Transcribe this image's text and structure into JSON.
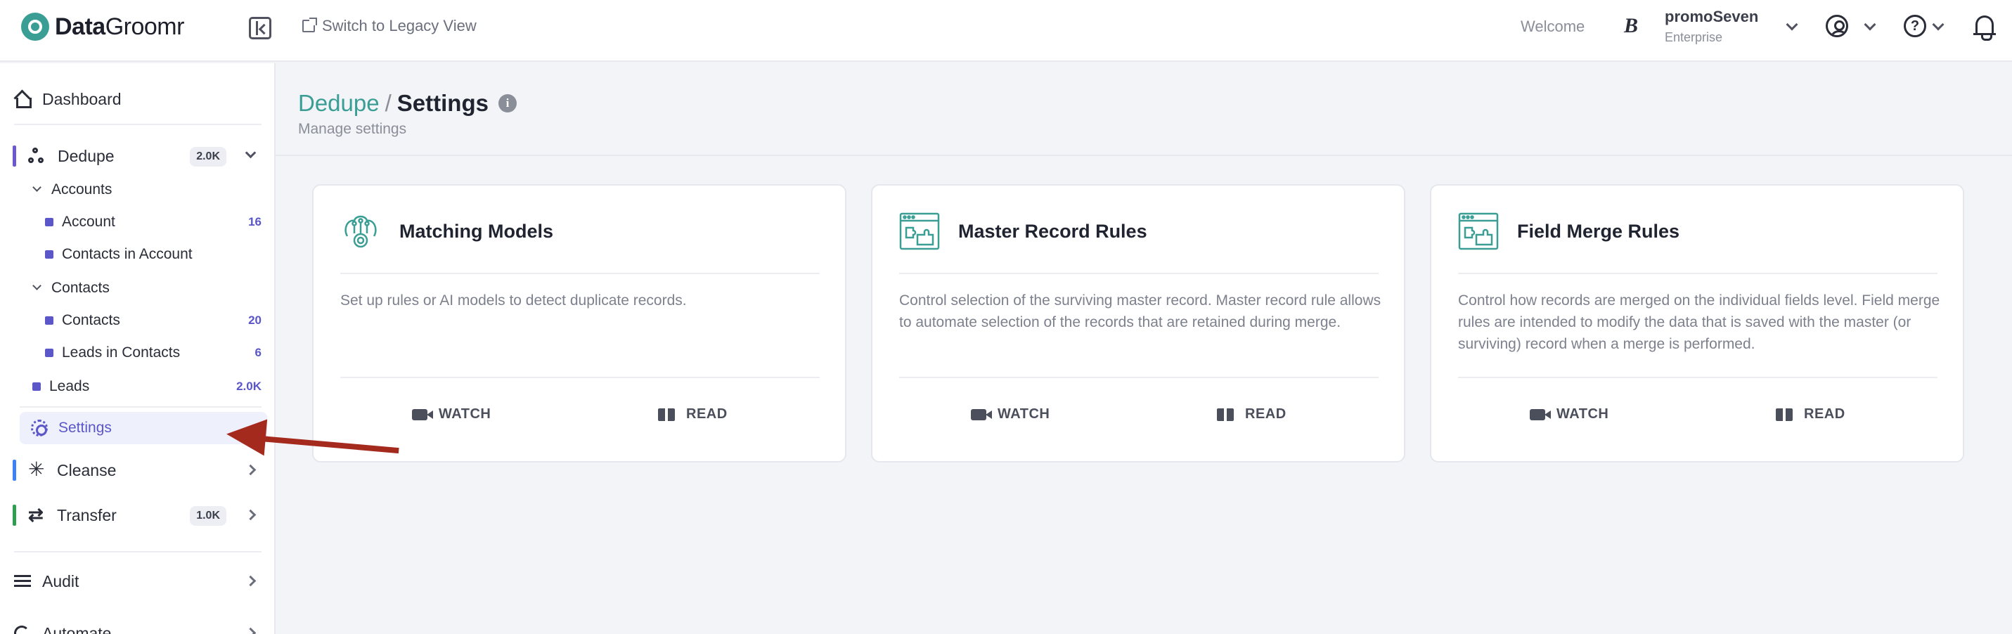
{
  "header": {
    "logo_bold": "Data",
    "logo_rest": "Groomr",
    "legacy_link": "Switch to Legacy View",
    "welcome": "Welcome",
    "brand_letter": "B",
    "user_name": "promoSeven",
    "user_plan": "Enterprise"
  },
  "sidebar": {
    "dashboard": "Dashboard",
    "dedupe": {
      "label": "Dedupe",
      "badge": "2.0K",
      "accent": "#6a5acd"
    },
    "accounts": "Accounts",
    "account": {
      "label": "Account",
      "count": "16"
    },
    "contacts_in_account": "Contacts in Account",
    "contacts_group": "Contacts",
    "contacts": {
      "label": "Contacts",
      "count": "20"
    },
    "leads_in_contacts": {
      "label": "Leads in Contacts",
      "count": "6"
    },
    "leads": {
      "label": "Leads",
      "count": "2.0K"
    },
    "settings": "Settings",
    "cleanse": {
      "label": "Cleanse",
      "accent": "#3b82f6"
    },
    "transfer": {
      "label": "Transfer",
      "badge": "1.0K",
      "accent": "#2e9e4f"
    },
    "audit": "Audit",
    "automate": "Automate"
  },
  "main": {
    "breadcrumb_parent": "Dedupe",
    "breadcrumb_separator": "/",
    "breadcrumb_current": "Settings",
    "subtitle": "Manage settings",
    "cards": [
      {
        "title": "Matching Models",
        "description": "Set up rules or AI models to detect duplicate records.",
        "icon": "ai-brain-icon",
        "watch": "WATCH",
        "read": "READ"
      },
      {
        "title": "Master Record Rules",
        "description": "Control selection of the surviving master record. Master record rule allows to automate selection of the records that are retained during merge.",
        "icon": "browser-puzzle-icon",
        "watch": "WATCH",
        "read": "READ"
      },
      {
        "title": "Field Merge Rules",
        "description": "Control how records are merged on the individual fields level. Field merge rules are intended to modify the data that is saved with the master (or surviving) record when a merge is performed.",
        "icon": "browser-puzzle-icon",
        "watch": "WATCH",
        "read": "READ"
      }
    ]
  },
  "colors": {
    "brand_teal": "#3a9e95",
    "accent_purple": "#5c57c9",
    "annotation_arrow": "#a52a1e"
  }
}
